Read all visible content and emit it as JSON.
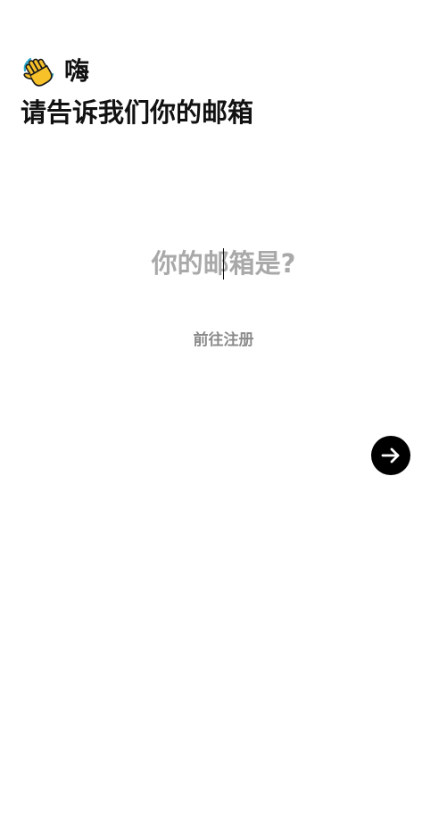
{
  "header": {
    "greeting_icon": "waving-hand-icon",
    "greeting_text": "嗨",
    "headline": "请告诉我们你的邮箱"
  },
  "form": {
    "email_placeholder": "你的邮箱是?",
    "email_value": ""
  },
  "links": {
    "register_label": "前往注册"
  },
  "actions": {
    "next_icon": "arrow-right-icon"
  },
  "colors": {
    "placeholder": "#a9a9a9",
    "link": "#8a8a8a",
    "button_bg": "#000000",
    "icon_fill": "#ffffff",
    "wave_skin": "#f7c12a",
    "wave_outline": "#1a1a1a"
  }
}
